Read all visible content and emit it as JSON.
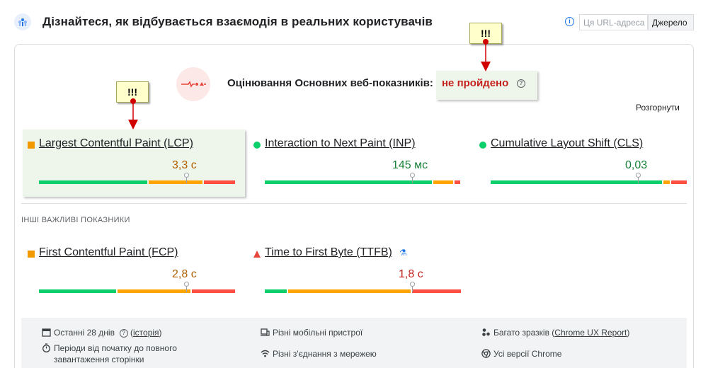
{
  "header": {
    "title": "Дізнайтеся, як відбувається взаємодія в реальних користувачів",
    "url_tab": "Ця URL-адреса",
    "source_tab": "Джерело",
    "logo_icon": "crux-people-icon",
    "info_icon": "info-icon"
  },
  "assessment": {
    "title": "Оцінювання Основних веб-показників:",
    "status": "не пройдено",
    "status_color": "#c5221f",
    "expand": "Розгорнути"
  },
  "callouts": {
    "top": "!!!",
    "left": "!!!"
  },
  "core_metrics": [
    {
      "name": "Largest Contentful Paint (LCP)",
      "value": "3,3 с",
      "rating": "needs-improvement",
      "color": "#b06000",
      "marker": "square",
      "good": 0.56,
      "ni": 0.28,
      "poor": 0.16,
      "position": 0.75
    },
    {
      "name": "Interaction to Next Paint (INP)",
      "value": "145 мс",
      "rating": "good",
      "color": "#188038",
      "marker": "circle",
      "good": 0.86,
      "ni": 0.11,
      "poor": 0.03,
      "position": 0.75
    },
    {
      "name": "Cumulative Layout Shift (CLS)",
      "value": "0,03",
      "rating": "good",
      "color": "#188038",
      "marker": "circle",
      "good": 0.88,
      "ni": 0.04,
      "poor": 0.08,
      "position": 0.75
    }
  ],
  "other": {
    "label": "ІНШІ ВАЖЛИВІ ПОКАЗНИКИ",
    "metrics": [
      {
        "name": "First Contentful Paint (FCP)",
        "value": "2,8 с",
        "rating": "needs-improvement",
        "color": "#b06000",
        "marker": "square",
        "good": 0.4,
        "ni": 0.38,
        "poor": 0.22,
        "position": 0.75
      },
      {
        "name": "Time to First Byte (TTFB)",
        "value": "1,8 с",
        "rating": "poor",
        "color": "#c5221f",
        "marker": "triangle",
        "good": 0.12,
        "ni": 0.63,
        "poor": 0.25,
        "position": 0.75,
        "lab_icon": "flask-icon"
      }
    ]
  },
  "footer": {
    "period": {
      "icon": "calendar-icon",
      "text": "Останні 28 днів",
      "help_icon": "help-icon",
      "link": "історія"
    },
    "devices": {
      "icon": "devices-icon",
      "text": "Різні мобільні пристрої"
    },
    "samples": {
      "icon": "samples-icon",
      "text_before": "Багато зразків (",
      "link": "Chrome UX Report",
      "text_after": ")"
    },
    "duration": {
      "icon": "stopwatch-icon",
      "text": "Періоди від початку до повного завантаження сторінки"
    },
    "network": {
      "icon": "wifi-icon",
      "text": "Різні з'єднання з мережею"
    },
    "chrome": {
      "icon": "chrome-icon",
      "text": "Усі версії Chrome"
    }
  }
}
